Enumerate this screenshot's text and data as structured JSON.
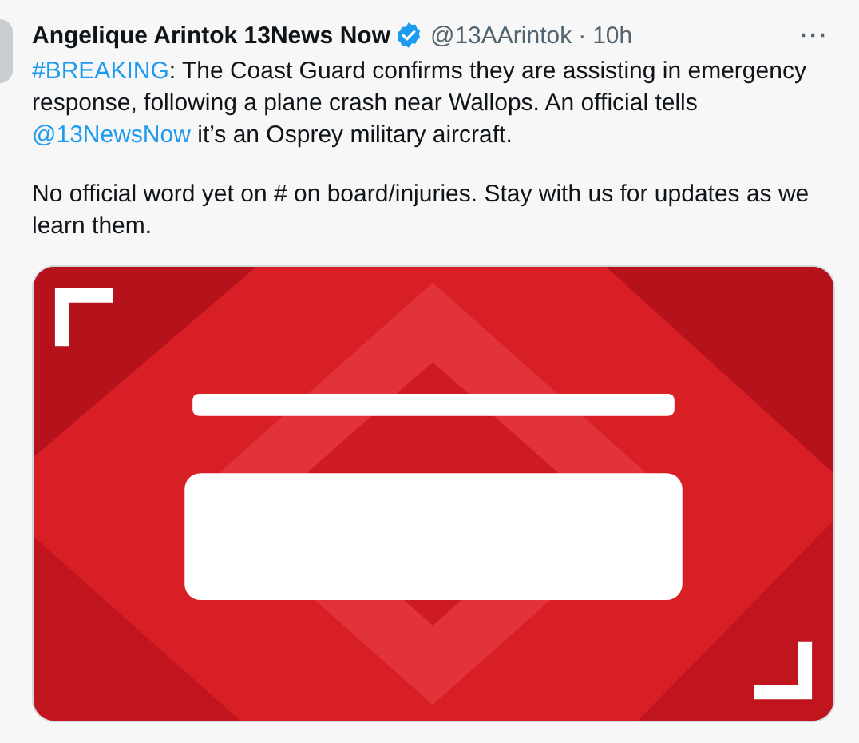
{
  "tweet": {
    "author_name": "Angelique Arintok 13News Now",
    "verified": true,
    "handle": "@13AArintok",
    "separator": "·",
    "time": "10h",
    "more": "···",
    "paragraphs": [
      [
        {
          "kind": "link",
          "text": "#BREAKING"
        },
        {
          "kind": "text",
          "text": ": The Coast Guard confirms they are assisting in emergency response, following a plane crash near Wallops. An official tells "
        },
        {
          "kind": "link",
          "text": "@13NewsNow"
        },
        {
          "kind": "text",
          "text": " it’s an Osprey military aircraft."
        }
      ],
      [
        {
          "kind": "text",
          "text": "No official word yet on # on board/injuries. Stay with us for updates as we learn them."
        }
      ]
    ],
    "media": {
      "kind": "picture"
    }
  }
}
